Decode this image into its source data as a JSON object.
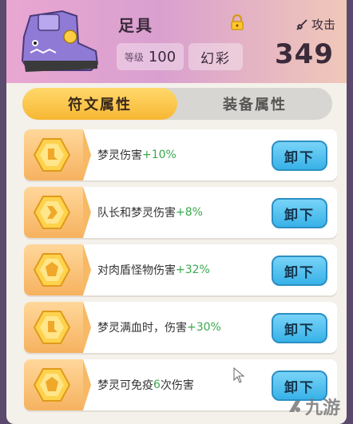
{
  "header": {
    "title": "足具",
    "attack_label": "攻击",
    "level_label": "等级",
    "level_value": "100",
    "quality": "幻彩",
    "power": "349",
    "lock_icon": "lock-icon",
    "sword_icon": "sword-icon"
  },
  "tabs": [
    {
      "label": "符文属性",
      "active": true
    },
    {
      "label": "装备属性",
      "active": false
    }
  ],
  "runes": [
    {
      "text": "梦灵伤害",
      "bonus": "+10%",
      "button": "卸下"
    },
    {
      "text": "队长和梦灵伤害",
      "bonus": "+8%",
      "button": "卸下"
    },
    {
      "text": "对肉盾怪物伤害",
      "bonus": "+32%",
      "button": "卸下"
    },
    {
      "text": "梦灵满血时，伤害",
      "bonus": "+30%",
      "button": "卸下"
    },
    {
      "text_before": "梦灵可免疫",
      "num": "6",
      "text_after": "次伤害",
      "button": "卸下"
    }
  ],
  "watermark": "九游",
  "colors": {
    "accent": "#f7b733",
    "bonus": "#39a94d",
    "button": "#38b2e8"
  }
}
